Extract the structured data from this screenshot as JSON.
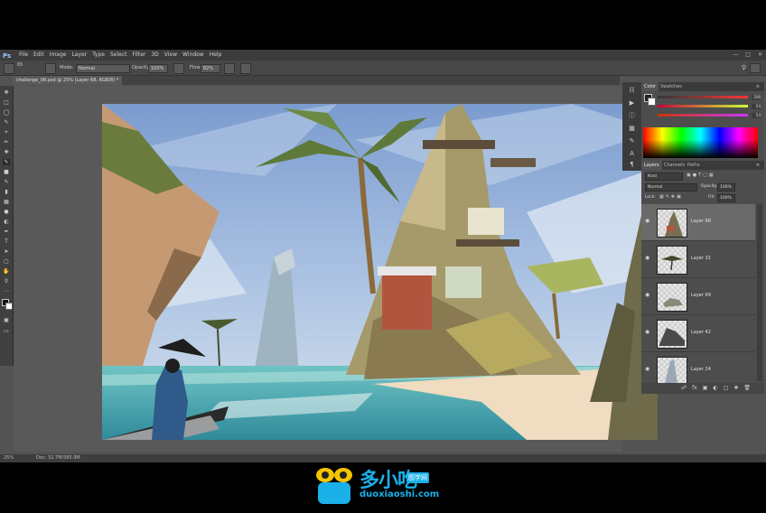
{
  "app": {
    "logo": "Ps"
  },
  "menubar": {
    "items": [
      "File",
      "Edit",
      "Image",
      "Layer",
      "Type",
      "Select",
      "Filter",
      "3D",
      "View",
      "Window",
      "Help"
    ]
  },
  "options": {
    "brush_size": "65",
    "mode_label": "Mode:",
    "mode_value": "Normal",
    "opacity_label": "Opacity:",
    "opacity_value": "100%",
    "flow_label": "Flow:",
    "flow_value": "82%"
  },
  "document": {
    "tab_title": "challenge_08.psd @ 25% (Layer 68, RGB/8) *"
  },
  "status": {
    "zoom": "25%",
    "doc_info": "Doc: 32.7M/585.9M"
  },
  "color_panel": {
    "tabs": [
      "Color",
      "Swatches"
    ],
    "values": [
      "206",
      "54",
      "54"
    ]
  },
  "layers_panel": {
    "tabs": [
      "Layers",
      "Channels",
      "Paths"
    ],
    "kind_label": "Kind",
    "blend_mode": "Normal",
    "opacity_label": "Opacity:",
    "opacity_value": "100%",
    "lock_label": "Lock:",
    "fill_label": "Fill:",
    "fill_value": "100%",
    "layers": [
      {
        "name": "Layer 68",
        "selected": true
      },
      {
        "name": "Layer 31",
        "selected": false
      },
      {
        "name": "Layer 69",
        "selected": false
      },
      {
        "name": "Layer 42",
        "selected": false
      },
      {
        "name": "Layer 24",
        "selected": false
      }
    ]
  },
  "watermark": {
    "brand": "多小吃",
    "tag": "图学网",
    "url": "duoxiaoshi.com"
  },
  "colors": {
    "accent": "#1ab0e8",
    "panel_bg": "#535353",
    "menubar_bg": "#3c3c3c"
  }
}
